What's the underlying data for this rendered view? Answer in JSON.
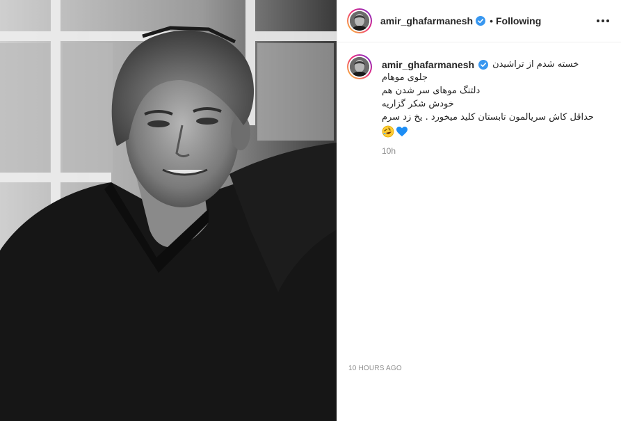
{
  "post": {
    "username": "amir_ghafarmanesh",
    "separator": "•",
    "follow_status": "Following",
    "more_label": "More options",
    "photo_alt": "Black and white portrait photo"
  },
  "caption": {
    "username": "amir_ghafarmanesh",
    "lines": [
      "خسته شدم از تراشیدن",
      "جلوی موهام",
      "دلتنگ موهای سر شدن هم",
      "خودش شکر گزاریه",
      "حداقل کاش سریالمون تابستان کلید میخورد . یخ زد سرم"
    ],
    "emojis": [
      "rolling-on-floor-laughing",
      "blue-heart"
    ],
    "relative_time": "10h"
  },
  "footer": {
    "timestamp": "10 HOURS AGO"
  },
  "colors": {
    "verified": "#3897f0",
    "heart": "#1d8ef5",
    "muted": "#8e8e8e",
    "text": "#262626"
  }
}
